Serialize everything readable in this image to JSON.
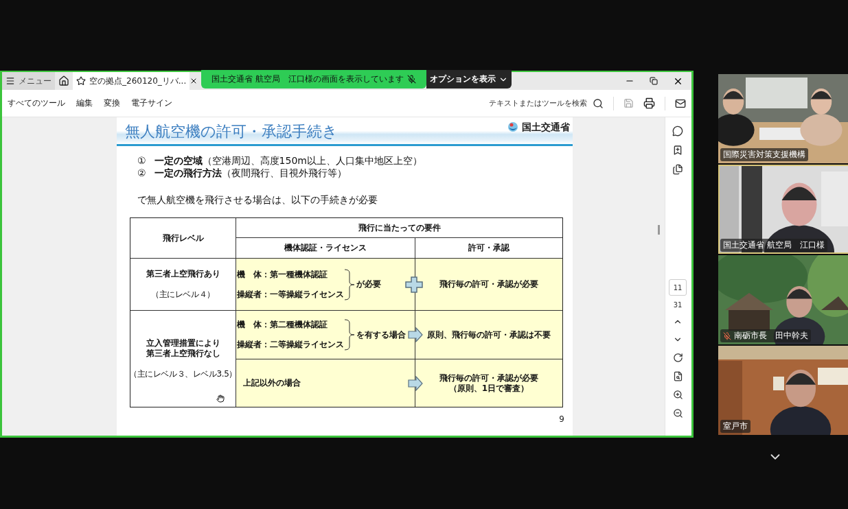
{
  "share_banner": {
    "text": "国土交通省 航空局　江口様の画面を表示しています",
    "muted": true
  },
  "options_button": {
    "label": "オプションを表示"
  },
  "tabs": [
    {
      "kind": "menu",
      "label": "メニュー",
      "selected": false
    },
    {
      "kind": "home",
      "selected": false
    },
    {
      "kind": "document",
      "label": "空の拠点_260120_リバ...",
      "selected": true
    }
  ],
  "toolbar": {
    "items": [
      "すべてのツール",
      "編集",
      "変換",
      "電子サイン"
    ],
    "search": {
      "placeholder": "テキストまたはツールを検索"
    },
    "save_disabled": true
  },
  "slide": {
    "title": "無人航空機の許可・承認手続き",
    "org": "国土交通省",
    "conditions": [
      {
        "num": "①",
        "text": "**一定の空域**（空港周辺、高度150m以上、人口集中地区上空）"
      },
      {
        "num": "②",
        "text": "**一定の飛行方法**（夜間飛行、目視外飛行等）"
      }
    ],
    "intro": "で無人航空機を飛行させる場合は、以下の手続きが必要",
    "table": {
      "level_header": "飛行レベル",
      "requirements_header": "飛行に当たっての要件",
      "columns": [
        "機体認証・ライセンス",
        "許可・承認"
      ],
      "groups": [
        {
          "level_lines": [
            "第三者上空飛行あり"
          ],
          "note": "（主にレベル４）",
          "cases": [
            {
              "lines": [
                "機　体：第一種機体認証",
                "操縦者：一等操縦ライセンス"
              ],
              "suffix": "が必要",
              "kind": "plus",
              "approval": [
                "飛行毎の許可・承認が必要"
              ]
            }
          ]
        },
        {
          "level_lines": [
            "立入管理措置により",
            "第三者上空飛行なし"
          ],
          "note": "（主にレベル３、レベル3.5）",
          "cases": [
            {
              "lines": [
                "機　体：第二種機体認証",
                "操縦者：二等操縦ライセンス"
              ],
              "suffix": "を有する場合",
              "kind": "arrow",
              "approval": [
                "原則、飛行毎の許可・承認は不要"
              ]
            },
            {
              "lines": [
                "上記以外の場合"
              ],
              "kind": "arrow",
              "approval": [
                "飛行毎の許可・承認が必要",
                "（原則、1日で審査）"
              ]
            }
          ]
        }
      ]
    },
    "page_number": "9"
  },
  "page_nav": {
    "current": "11",
    "total": "31"
  },
  "participants": [
    {
      "name": "国際災害対策支援機構",
      "active": false,
      "muted": false
    },
    {
      "name": "国土交通省 航空局　江口様",
      "active": true,
      "muted": false
    },
    {
      "name": "南砺市長　田中幹夫",
      "active": false,
      "muted": true
    },
    {
      "name": "室戸市",
      "active": false,
      "muted": false
    }
  ]
}
